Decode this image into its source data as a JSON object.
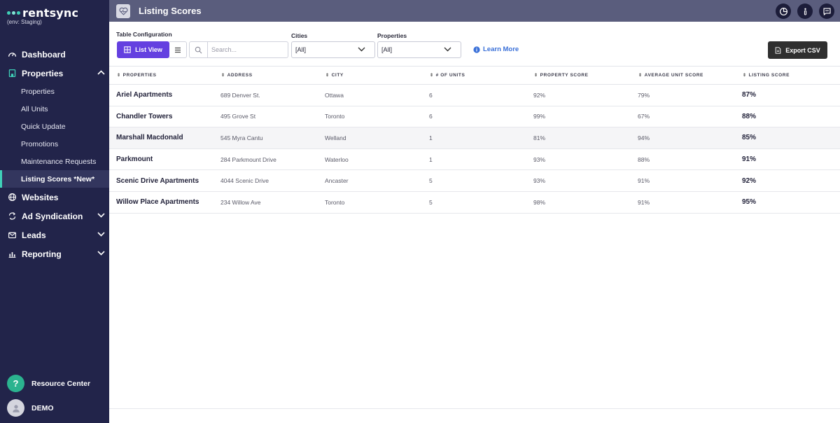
{
  "brand": {
    "name": "rentsync",
    "env": "(env: Staging)"
  },
  "nav": {
    "dashboard": "Dashboard",
    "properties": "Properties",
    "sub_items": [
      "Properties",
      "All Units",
      "Quick Update",
      "Promotions",
      "Maintenance Requests",
      "Listing Scores *New*"
    ],
    "websites": "Websites",
    "ad_syndication": "Ad Syndication",
    "leads": "Leads",
    "reporting": "Reporting"
  },
  "bottom": {
    "resource_center": "Resource Center",
    "user": "DEMO"
  },
  "topbar": {
    "title": "Listing Scores"
  },
  "controls": {
    "table_config_label": "Table Configuration",
    "list_view_label": "List View",
    "search_placeholder": "Search...",
    "cities_label": "Cities",
    "cities_value": "[All]",
    "properties_label": "Properties",
    "properties_value": "[All]",
    "learn_more": "Learn More",
    "export_csv": "Export CSV"
  },
  "table": {
    "headers": [
      "PROPERTIES",
      "ADDRESS",
      "CITY",
      "# OF UNITS",
      "PROPERTY SCORE",
      "AVERAGE UNIT SCORE",
      "LISTING SCORE"
    ],
    "rows": [
      [
        "Ariel Apartments",
        "689 Denver St.",
        "Ottawa",
        "6",
        "92%",
        "79%",
        "87%"
      ],
      [
        "Chandler Towers",
        "495 Grove St",
        "Toronto",
        "6",
        "99%",
        "67%",
        "88%"
      ],
      [
        "Marshall Macdonald",
        "545 Myra Cantu",
        "Welland",
        "1",
        "81%",
        "94%",
        "85%"
      ],
      [
        "Parkmount",
        "284 Parkmount Drive",
        "Waterloo",
        "1",
        "93%",
        "88%",
        "91%"
      ],
      [
        "Scenic Drive Apartments",
        "4044 Scenic Drive",
        "Ancaster",
        "5",
        "93%",
        "91%",
        "92%"
      ],
      [
        "Willow Place Apartments",
        "234 Willow Ave",
        "Toronto",
        "5",
        "98%",
        "91%",
        "95%"
      ]
    ]
  },
  "colors": {
    "sidebar": "#22244a",
    "topbar": "#5a5d7d",
    "accent_teal": "#3fd1b8",
    "primary_purple": "#6440e0",
    "link_blue": "#3a70d8",
    "export_dark": "#2f2f2f"
  }
}
